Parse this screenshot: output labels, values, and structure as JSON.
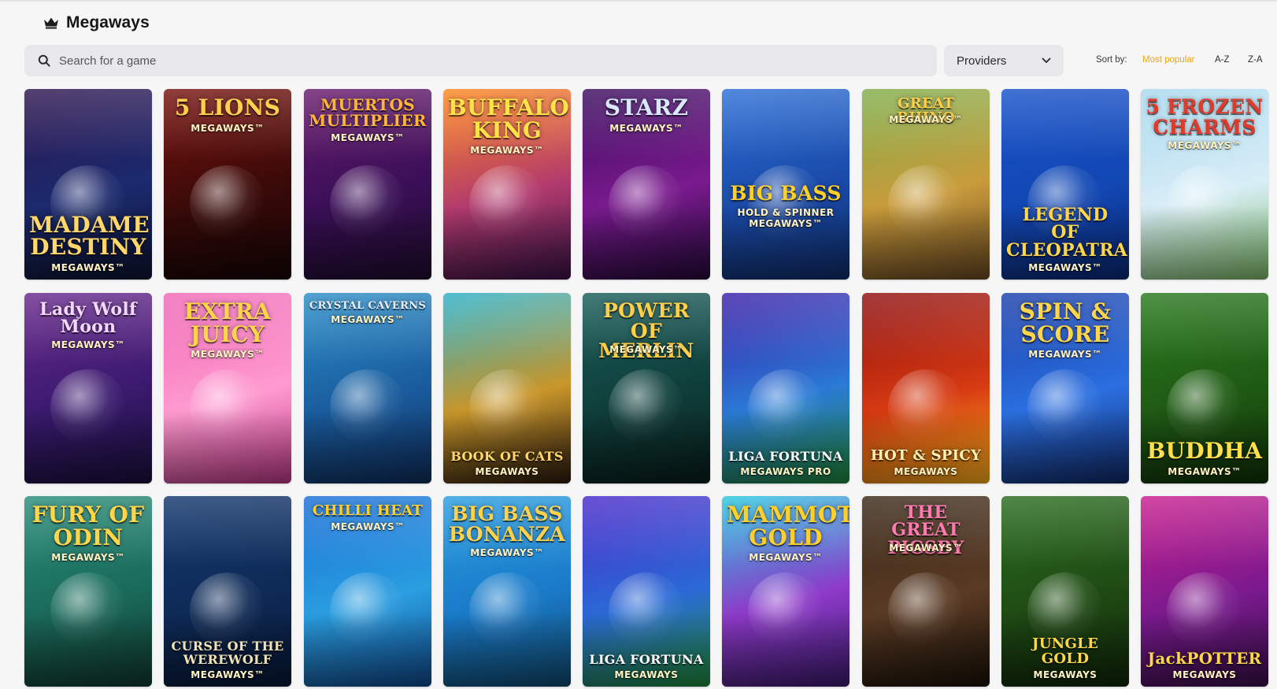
{
  "header": {
    "title": "Megaways",
    "icon": "crown-icon"
  },
  "search": {
    "placeholder": "Search for a game",
    "value": ""
  },
  "providers": {
    "label": "Providers"
  },
  "sort": {
    "label": "Sort by:",
    "options": [
      "Most popular",
      "A-Z",
      "Z-A"
    ],
    "active": "Most popular",
    "active_color": "#e9a514"
  },
  "games": [
    {
      "title": "MADAME\nDESTINY",
      "badge": "MEGAWAYS™",
      "colors": [
        "#2f1650",
        "#1b2a6e",
        "#0d1430"
      ],
      "text_color": "#ffd76a",
      "title_pos": "bottom"
    },
    {
      "title": "5 LIONS",
      "badge": "MEGAWAYS™",
      "colors": [
        "#7a1410",
        "#3a0a08",
        "#170505"
      ],
      "text_color": "#ffcf4d",
      "title_pos": "top"
    },
    {
      "title": "MUERTOS\nMULTIPLIER",
      "badge": "MEGAWAYS™",
      "colors": [
        "#6a1c6e",
        "#3a0f57",
        "#1f0c2e"
      ],
      "text_color": "#ffb43d",
      "title_pos": "top"
    },
    {
      "title": "BUFFALO\nKING",
      "badge": "MEGAWAYS™",
      "colors": [
        "#ff8a1d",
        "#b33b6e",
        "#3a1247"
      ],
      "text_color": "#ffe14a",
      "title_pos": "top"
    },
    {
      "title": "STARZ",
      "badge": "MEGAWAYS™",
      "colors": [
        "#3b0d5e",
        "#7a1a8e",
        "#24093a"
      ],
      "text_color": "#d9e8ff",
      "title_pos": "top"
    },
    {
      "title": "BIG BASS",
      "badge": "HOLD & SPINNER MEGAWAYS™",
      "colors": [
        "#2d6fd6",
        "#1a4aa8",
        "#0f2d6a"
      ],
      "text_color": "#ffcf2a",
      "title_pos": "middle"
    },
    {
      "title": "GREAT RHINO",
      "badge": "MEGAWAYS™",
      "colors": [
        "#7fae4a",
        "#c99b3b",
        "#6a4a22"
      ],
      "text_color": "#ffcf4a",
      "title_pos": "top"
    },
    {
      "title": "LEGEND\nOF\nCLEOPATRA",
      "badge": "MEGAWAYS™",
      "colors": [
        "#1852c9",
        "#1247b3",
        "#0a2a78"
      ],
      "text_color": "#ffd54a",
      "title_pos": "bottom"
    },
    {
      "title": "5 FROZEN\nCHARMS",
      "badge": "MEGAWAYS™",
      "colors": [
        "#a8d8ee",
        "#d9eef7",
        "#7fbf6a"
      ],
      "text_color": "#e23a2a",
      "title_pos": "top"
    },
    {
      "title": "Lady Wolf\nMoon",
      "badge": "MEGAWAYS™",
      "colors": [
        "#6a2a8e",
        "#3a1a6e",
        "#1a0f3e"
      ],
      "text_color": "#f4d7ff",
      "title_pos": "top"
    },
    {
      "title": "EXTRA\nJUICY",
      "badge": "MEGAWAYS™",
      "colors": [
        "#f067b5",
        "#ff9bd0",
        "#c23a8a"
      ],
      "text_color": "#ffd34a",
      "title_pos": "top"
    },
    {
      "title": "CRYSTAL CAVERNS",
      "badge": "MEGAWAYS™",
      "colors": [
        "#2d8fc9",
        "#1a5c9e",
        "#0e2f5e"
      ],
      "text_color": "#e7f1ff",
      "title_pos": "top"
    },
    {
      "title": "BOOK OF CATS",
      "badge": "MEGAWAYS",
      "colors": [
        "#2ab0c9",
        "#c9962a",
        "#2a1a0e"
      ],
      "text_color": "#ffd76a",
      "title_pos": "bottom"
    },
    {
      "title": "POWER OF\nMERLIN",
      "badge": "MEGAWAYS™",
      "colors": [
        "#1a5e5a",
        "#0f3e3a",
        "#081e1c"
      ],
      "text_color": "#ffcf4a",
      "title_pos": "top"
    },
    {
      "title": "LIGA FORTUNA",
      "badge": "MEGAWAYS PRO",
      "colors": [
        "#3b1fa8",
        "#2a7ad6",
        "#1f8a3a"
      ],
      "text_color": "#ffffff",
      "title_pos": "bottom"
    },
    {
      "title": "HOT & SPICY",
      "badge": "MEGAWAYS",
      "colors": [
        "#8e0f0f",
        "#d63a12",
        "#ffb21a"
      ],
      "text_color": "#fff1b0",
      "title_pos": "bottom"
    },
    {
      "title": "SPIN &\nSCORE",
      "badge": "MEGAWAYS™",
      "colors": [
        "#1a3fa8",
        "#2b6fe0",
        "#0f2a6a"
      ],
      "text_color": "#ffd54a",
      "title_pos": "top"
    },
    {
      "title": "BUDDHA",
      "badge": "MEGAWAYS™",
      "colors": [
        "#2a7a1f",
        "#1f5a14",
        "#0f3208"
      ],
      "text_color": "#ffdf4a",
      "title_pos": "bottom"
    },
    {
      "title": "FURY OF\nODIN",
      "badge": "MEGAWAYS™",
      "colors": [
        "#2a8e7a",
        "#1a6a5a",
        "#0f3a30"
      ],
      "text_color": "#ffd54a",
      "title_pos": "top"
    },
    {
      "title": "CURSE OF THE\nWEREWOLF",
      "badge": "MEGAWAYS™",
      "colors": [
        "#14386e",
        "#0e2a56",
        "#081836"
      ],
      "text_color": "#f0e2b6",
      "title_pos": "bottom"
    },
    {
      "title": "CHILLI HEAT",
      "badge": "MEGAWAYS™",
      "colors": [
        "#1a6fd6",
        "#2a9ee0",
        "#0f4a8e"
      ],
      "text_color": "#ffcf2a",
      "title_pos": "top"
    },
    {
      "title": "BIG BASS\nBONANZA",
      "badge": "MEGAWAYS™",
      "colors": [
        "#2a9ee0",
        "#1a7ac9",
        "#0f4a6e"
      ],
      "text_color": "#ffd24a",
      "title_pos": "top"
    },
    {
      "title": "LIGA FORTUNA",
      "badge": "MEGAWAYS",
      "colors": [
        "#4a2ac9",
        "#2a6ad6",
        "#1f8e3a"
      ],
      "text_color": "#ffffff",
      "title_pos": "bottom"
    },
    {
      "title": "MAMMOTH\nGOLD",
      "badge": "MEGAWAYS™",
      "colors": [
        "#2ac9e0",
        "#8e3ac9",
        "#3a1a6e"
      ],
      "text_color": "#ffcf2a",
      "title_pos": "top"
    },
    {
      "title": "THE GREAT\nPIGSBY",
      "badge": "MEGAWAYS™",
      "colors": [
        "#3a2a1a",
        "#5a3a24",
        "#1a1208"
      ],
      "text_color": "#ff7ab0",
      "title_pos": "top"
    },
    {
      "title": "JUNGLE GOLD",
      "badge": "MEGAWAYS",
      "colors": [
        "#2a6e1f",
        "#1f4a14",
        "#0f2608"
      ],
      "text_color": "#ffd54a",
      "title_pos": "bottom"
    },
    {
      "title": "JackPOTTER",
      "badge": "MEGAWAYS",
      "colors": [
        "#c91f8e",
        "#7a1a8e",
        "#3a0f4a"
      ],
      "text_color": "#ffd54a",
      "title_pos": "bottom"
    }
  ]
}
